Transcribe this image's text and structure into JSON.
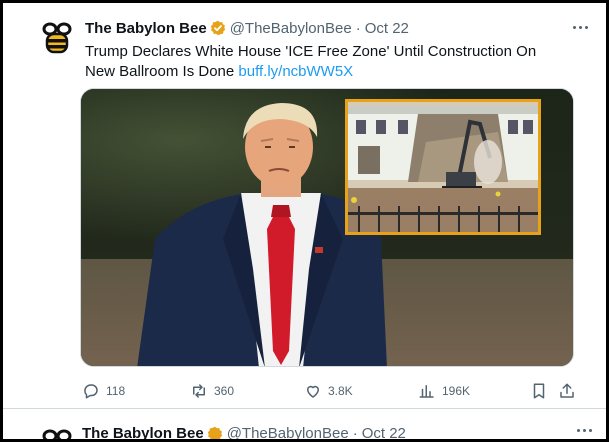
{
  "colors": {
    "link": "#1d9bf0",
    "secondary_text": "#536471",
    "verified_badge": "#e8a21a",
    "inset_border": "#e8a21a",
    "suit": "#1c2a4a",
    "tie": "#d11a2a"
  },
  "tweet": {
    "author_name": "The Babylon Bee",
    "handle": "@TheBabylonBee",
    "separator": "·",
    "date": "Oct 22",
    "text": "Trump Declares White House 'ICE Free Zone' Until Construction On New Ballroom Is Done",
    "link": "buff.ly/ncbWW5X",
    "avatar_icon": "bee-logo-icon",
    "verified_icon": "verified-badge-icon",
    "more_icon": "more-options-icon"
  },
  "actions": {
    "replies": "118",
    "reposts": "360",
    "likes": "3.8K",
    "views": "196K",
    "reply_icon": "reply-icon",
    "repost_icon": "repost-icon",
    "like_icon": "heart-icon",
    "views_icon": "views-chart-icon",
    "bookmark_icon": "bookmark-icon",
    "share_icon": "share-icon"
  },
  "next_tweet": {
    "author_name": "The Babylon Bee",
    "handle": "@TheBabylonBee",
    "separator": "·",
    "date": "Oct 22"
  }
}
